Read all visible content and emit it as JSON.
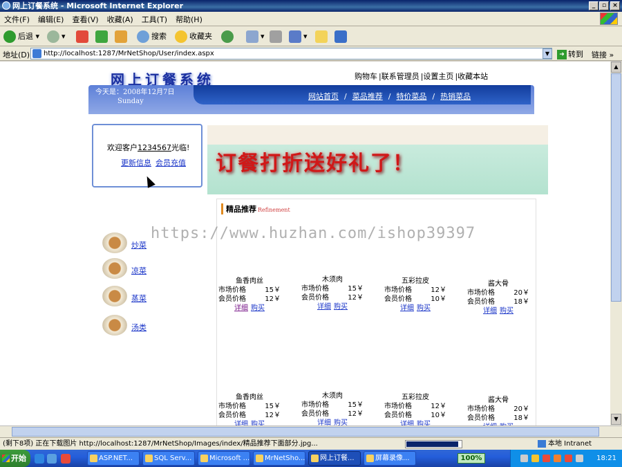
{
  "window": {
    "title": "网上订餐系统 - Microsoft Internet Explorer"
  },
  "menu": [
    "文件(F)",
    "编辑(E)",
    "查看(V)",
    "收藏(A)",
    "工具(T)",
    "帮助(H)"
  ],
  "toolbar": {
    "back": "后退",
    "search": "搜索",
    "favorites": "收藏夹"
  },
  "address": {
    "label": "地址(D)",
    "url": "http://localhost:1287/MrNetShop/User/index.aspx",
    "go": "转到",
    "links": "链接"
  },
  "page": {
    "logo": "网上订餐系统",
    "topnav": [
      "购物车",
      "|联系管理员",
      "|设置主页",
      "|收藏本站"
    ],
    "date_line": "今天是：2008年12月7日",
    "weekday": "Sunday",
    "catnav": [
      "网站首页",
      "菜品推荐",
      "特价菜品",
      "热销菜品"
    ],
    "catnav_sep": "/",
    "welcome_prefix": "欢迎客户",
    "welcome_user": "1234567",
    "welcome_suffix": "光临!",
    "update_info": "更新信息",
    "member_recharge": "会员充值",
    "promo_text": "订餐打折送好礼了！",
    "rec_title": "精品推荐",
    "rec_title_en": "Refinement",
    "watermark": "https://www.huzhan.com/ishop39397",
    "categories": [
      "炒菜",
      "凉菜",
      "蒸菜",
      "汤类"
    ],
    "market_label": "市场价格",
    "member_label": "会员价格",
    "detail": "详细",
    "buy": "购买",
    "dishes": [
      {
        "name": "鱼香肉丝",
        "market": "15￥",
        "member": "12￥"
      },
      {
        "name": "木须肉",
        "market": "15￥",
        "member": "12￥"
      },
      {
        "name": "五彩拉皮",
        "market": "12￥",
        "member": "10￥"
      },
      {
        "name": "酱大骨",
        "market": "20￥",
        "member": "18￥"
      }
    ]
  },
  "status": {
    "text": "(剩下8项) 正在下载图片 http://localhost:1287/MrNetShop/Images/index/精品推荐下面部分.jpg...",
    "progress": 0.95,
    "zone": "本地 Intranet"
  },
  "taskbar": {
    "start": "开始",
    "tasks": [
      "ASP.NET...",
      "SQL Serv...",
      "Microsoft ...",
      "MrNetSho...",
      "网上订餐...",
      "屏幕录像..."
    ],
    "zoom": "100%",
    "clock": "18:21"
  }
}
